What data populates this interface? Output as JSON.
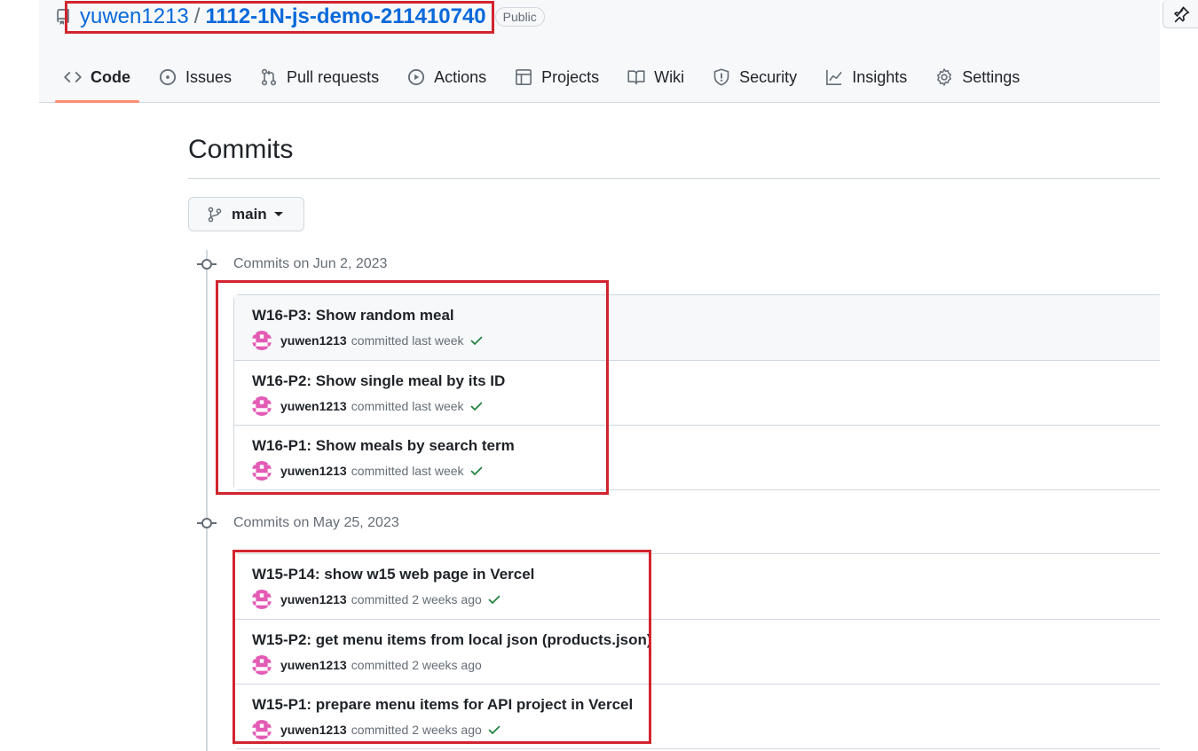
{
  "repo": {
    "owner": "yuwen1213",
    "separator": "/",
    "name": "1112-1N-js-demo-211410740",
    "visibility": "Public"
  },
  "tabs": [
    {
      "label": "Code",
      "icon": "code-icon",
      "active": true
    },
    {
      "label": "Issues",
      "icon": "issue-circle-icon"
    },
    {
      "label": "Pull requests",
      "icon": "pull-request-icon"
    },
    {
      "label": "Actions",
      "icon": "play-circle-icon"
    },
    {
      "label": "Projects",
      "icon": "table-icon"
    },
    {
      "label": "Wiki",
      "icon": "book-icon"
    },
    {
      "label": "Security",
      "icon": "shield-icon"
    },
    {
      "label": "Insights",
      "icon": "graph-icon"
    },
    {
      "label": "Settings",
      "icon": "gear-icon"
    }
  ],
  "page": {
    "title": "Commits"
  },
  "branch": {
    "name": "main",
    "icon": "git-branch-icon"
  },
  "groups": [
    {
      "heading": "Commits on Jun 2, 2023",
      "commits": [
        {
          "message": "W16-P3: Show random meal",
          "author": "yuwen1213",
          "action": "committed",
          "time": "last week",
          "verified": true
        },
        {
          "message": "W16-P2: Show single meal by its ID",
          "author": "yuwen1213",
          "action": "committed",
          "time": "last week",
          "verified": true
        },
        {
          "message": "W16-P1: Show meals by search term",
          "author": "yuwen1213",
          "action": "committed",
          "time": "last week",
          "verified": true
        }
      ]
    },
    {
      "heading": "Commits on May 25, 2023",
      "commits": [
        {
          "message": "W15-P14: show w15 web page in Vercel",
          "author": "yuwen1213",
          "action": "committed",
          "time": "2 weeks ago",
          "verified": true
        },
        {
          "message": "W15-P2: get menu items from local json (products.json)",
          "author": "yuwen1213",
          "action": "committed",
          "time": "2 weeks ago",
          "verified": false
        },
        {
          "message": "W15-P1: prepare menu items for API project in Vercel",
          "author": "yuwen1213",
          "action": "committed",
          "time": "2 weeks ago",
          "verified": true
        }
      ]
    }
  ],
  "colors": {
    "link": "#0969da",
    "accent_underline": "#fd8c73",
    "annotation_red": "#d1242f",
    "success_green": "#1a7f37",
    "avatar_pink": "#e35bb4"
  }
}
